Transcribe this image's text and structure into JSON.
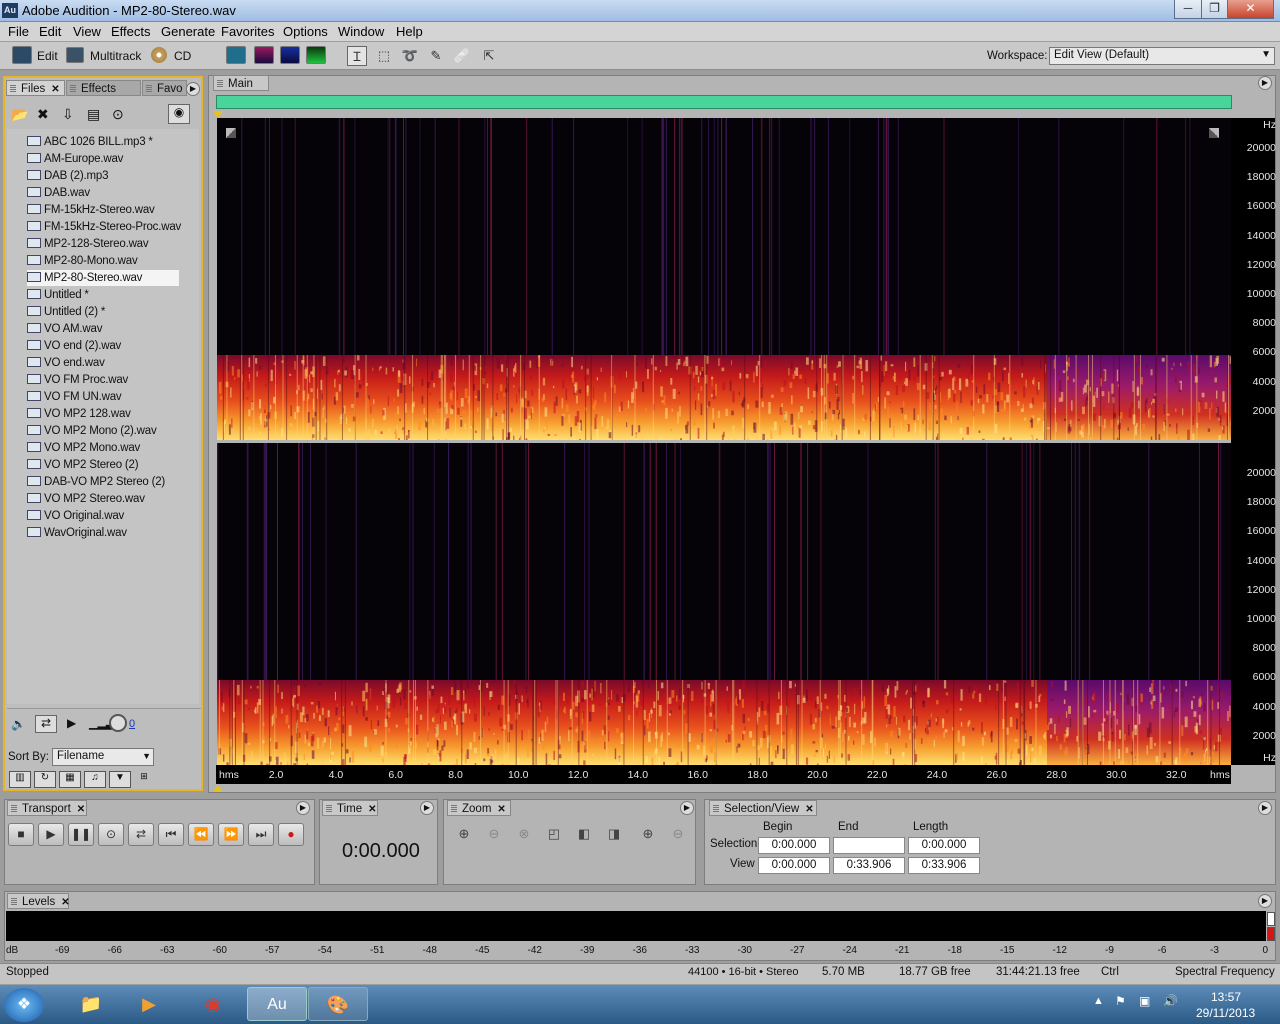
{
  "window": {
    "app_icon": "Au",
    "title": "Adobe Audition - MP2-80-Stereo.wav",
    "btn_min": "─",
    "btn_max": "❐",
    "btn_close": "✕"
  },
  "menu": [
    "File",
    "Edit",
    "View",
    "Effects",
    "Generate",
    "Favorites",
    "Options",
    "Window",
    "Help"
  ],
  "toolbar": {
    "edit_label": "Edit",
    "multitrack_label": "Multitrack",
    "cd_label": "CD",
    "workspace_label": "Workspace:",
    "workspace_value": "Edit View (Default)"
  },
  "files_panel": {
    "tabs": [
      "Files",
      "Effects",
      "Favo"
    ],
    "files": [
      "ABC 1026 BILL.mp3 *",
      "AM-Europe.wav",
      "DAB (2).mp3",
      "DAB.wav",
      "FM-15kHz-Stereo.wav",
      "FM-15kHz-Stereo-Proc.wav",
      "MP2-128-Stereo.wav",
      "MP2-80-Mono.wav",
      "MP2-80-Stereo.wav",
      "Untitled *",
      "Untitled (2) *",
      "VO AM.wav",
      "VO end (2).wav",
      "VO end.wav",
      "VO FM Proc.wav",
      "VO FM UN.wav",
      "VO MP2 128.wav",
      "VO MP2 Mono (2).wav",
      "VO MP2 Mono.wav",
      "VO MP2 Stereo (2)",
      "DAB-VO MP2 Stereo (2)",
      "VO MP2 Stereo.wav",
      "VO Original.wav",
      "WavOriginal.wav"
    ],
    "selected_file": "MP2-80-Stereo.wav",
    "volume_value": "0",
    "sort_label": "Sort By:",
    "sort_value": "Filename"
  },
  "main_panel": {
    "tab": "Main"
  },
  "spectrogram": {
    "y_unit": "Hz",
    "y_ticks": [
      "20000",
      "18000",
      "16000",
      "14000",
      "12000",
      "10000",
      "8000",
      "6000",
      "4000",
      "2000"
    ],
    "x_unit": "hms",
    "x_ticks": [
      "2.0",
      "4.0",
      "6.0",
      "8.0",
      "10.0",
      "12.0",
      "14.0",
      "16.0",
      "18.0",
      "20.0",
      "22.0",
      "24.0",
      "26.0",
      "28.0",
      "30.0",
      "32.0"
    ]
  },
  "transport": {
    "tab": "Transport"
  },
  "time": {
    "tab": "Time",
    "display": "0:00.000"
  },
  "zoom": {
    "tab": "Zoom"
  },
  "selection_view": {
    "tab": "Selection/View",
    "col_begin": "Begin",
    "col_end": "End",
    "col_length": "Length",
    "row_selection": "Selection",
    "row_view": "View",
    "selection_begin": "0:00.000",
    "selection_end": "",
    "selection_length": "0:00.000",
    "view_begin": "0:00.000",
    "view_end": "0:33.906",
    "view_length": "0:33.906"
  },
  "levels": {
    "tab": "Levels",
    "scale": [
      "dB",
      "-69",
      "-66",
      "-63",
      "-60",
      "-57",
      "-54",
      "-51",
      "-48",
      "-45",
      "-42",
      "-39",
      "-36",
      "-33",
      "-30",
      "-27",
      "-24",
      "-21",
      "-18",
      "-15",
      "-12",
      "-9",
      "-6",
      "-3",
      "0"
    ]
  },
  "status": {
    "state": "Stopped",
    "format": "44100 • 16-bit • Stereo",
    "size": "5.70 MB",
    "disk_free": "18.77 GB free",
    "time_free": "31:44:21.13 free",
    "ctrl": "Ctrl",
    "view_mode": "Spectral Frequency"
  },
  "taskbar": {
    "time": "13:57",
    "date": "29/11/2013"
  }
}
